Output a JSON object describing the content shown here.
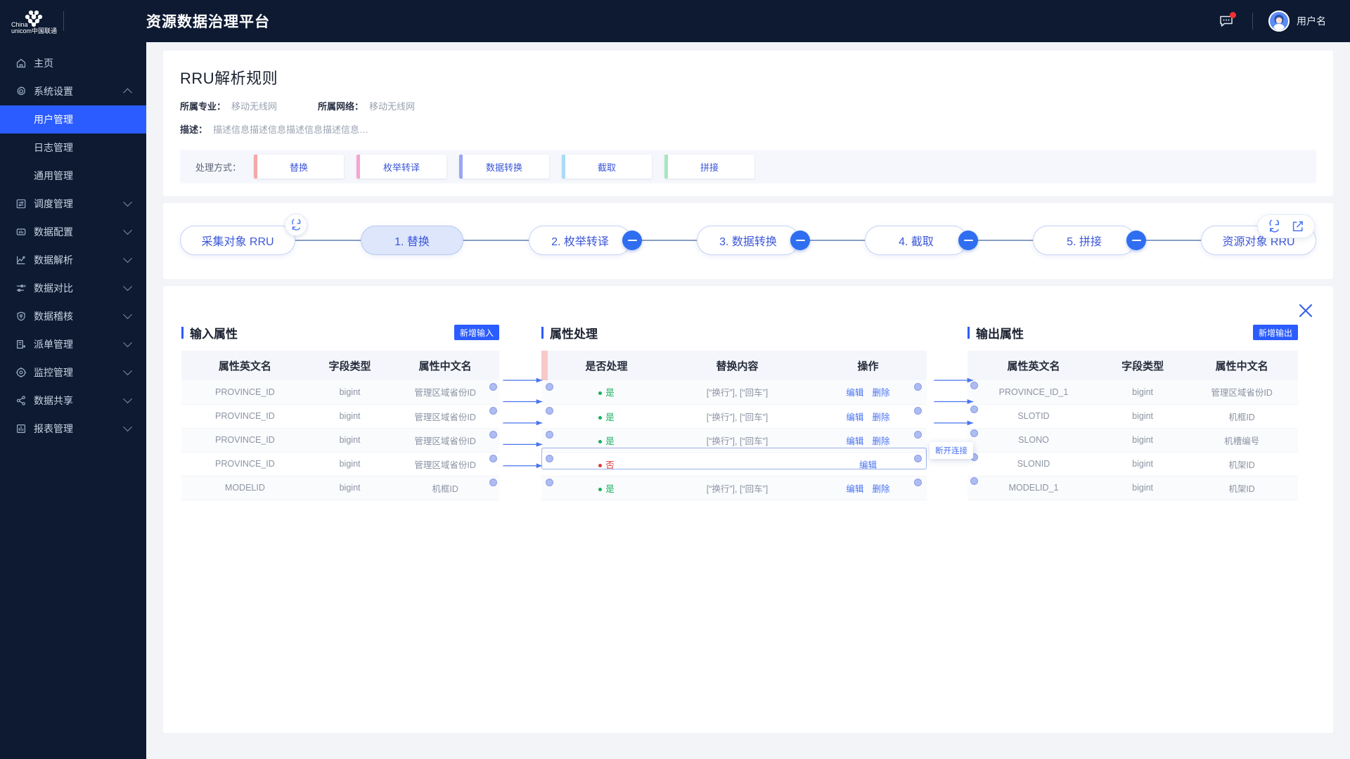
{
  "topbar": {
    "brand_title": "资源数据治理平台",
    "logo_line1": "China",
    "logo_line2": "unicom中国联通",
    "message_icon": "chat-bubble-icon",
    "user_name": "用户名"
  },
  "sidebar": {
    "items": [
      {
        "label": "主页",
        "icon": "home-icon",
        "type": "item",
        "expandable": false,
        "active": false
      },
      {
        "label": "系统设置",
        "icon": "gear-icon",
        "type": "item",
        "expandable": true,
        "expanded": true,
        "active": false
      },
      {
        "label": "用户管理",
        "icon": "",
        "type": "sub",
        "active": true
      },
      {
        "label": "日志管理",
        "icon": "",
        "type": "sub",
        "active": false
      },
      {
        "label": "通用管理",
        "icon": "",
        "type": "sub",
        "active": false
      },
      {
        "label": "调度管理",
        "icon": "schedule-icon",
        "type": "item",
        "expandable": true,
        "expanded": false,
        "active": false
      },
      {
        "label": "数据配置",
        "icon": "database-config-icon",
        "type": "item",
        "expandable": true,
        "expanded": false,
        "active": false
      },
      {
        "label": "数据解析",
        "icon": "chart-parse-icon",
        "type": "item",
        "expandable": true,
        "expanded": false,
        "active": false
      },
      {
        "label": "数据对比",
        "icon": "compare-icon",
        "type": "item",
        "expandable": true,
        "expanded": false,
        "active": false
      },
      {
        "label": "数据稽核",
        "icon": "audit-shield-icon",
        "type": "item",
        "expandable": true,
        "expanded": false,
        "active": false
      },
      {
        "label": "派单管理",
        "icon": "dispatch-icon",
        "type": "item",
        "expandable": true,
        "expanded": false,
        "active": false
      },
      {
        "label": "监控管理",
        "icon": "monitor-icon",
        "type": "item",
        "expandable": true,
        "expanded": false,
        "active": false
      },
      {
        "label": "数据共享",
        "icon": "share-icon",
        "type": "item",
        "expandable": true,
        "expanded": false,
        "active": false
      },
      {
        "label": "报表管理",
        "icon": "report-icon",
        "type": "item",
        "expandable": true,
        "expanded": false,
        "active": false
      }
    ]
  },
  "header": {
    "title": "RRU解析规则",
    "major_label": "所属专业：",
    "major_value": "移动无线网",
    "network_label": "所属网络：",
    "network_value": "移动无线网",
    "desc_label": "描述：",
    "desc_value": "描述信息描述信息描述信息描述信息…"
  },
  "method_strip": {
    "label": "处理方式：",
    "chips": [
      {
        "label": "替换",
        "accent": "#f6a7a7"
      },
      {
        "label": "枚举转译",
        "accent": "#f4a6d4"
      },
      {
        "label": "数据转换",
        "accent": "#9aa6f3"
      },
      {
        "label": "截取",
        "accent": "#a9dcf5"
      },
      {
        "label": "拼接",
        "accent": "#a8e6bd"
      }
    ]
  },
  "flow": {
    "source_node": "采集对象 RRU",
    "target_node": "资源对象 RRU",
    "steps": [
      {
        "label": "1. 替换",
        "active": true,
        "has_minus": false
      },
      {
        "label": "2. 枚举转译",
        "active": false,
        "has_minus": true
      },
      {
        "label": "3. 数据转换",
        "active": false,
        "has_minus": true
      },
      {
        "label": "4. 截取",
        "active": false,
        "has_minus": true
      },
      {
        "label": "5. 拼接",
        "active": false,
        "has_minus": true
      }
    ],
    "source_refresh_icon": "refresh-icon",
    "tools": [
      {
        "icon": "refresh-icon"
      },
      {
        "icon": "edit-square-icon"
      }
    ]
  },
  "mapping": {
    "close_icon": "close-icon",
    "tooltip": "断开连接",
    "input_panel": {
      "title": "输入属性",
      "add_label": "新增输入",
      "columns": [
        "属性英文名",
        "字段类型",
        "属性中文名"
      ],
      "rows": [
        [
          "PROVINCE_ID",
          "bigint",
          "管理区域省份ID"
        ],
        [
          "PROVINCE_ID",
          "bigint",
          "管理区域省份ID"
        ],
        [
          "PROVINCE_ID",
          "bigint",
          "管理区域省份ID"
        ],
        [
          "PROVINCE_ID",
          "bigint",
          "管理区域省份ID"
        ],
        [
          "MODELID",
          "bigint",
          "机框ID"
        ]
      ]
    },
    "process_panel": {
      "title": "属性处理",
      "columns": [
        "是否处理",
        "替换内容",
        "操作"
      ],
      "edit_label": "编辑",
      "delete_label": "删除",
      "rows": [
        {
          "handled": "是",
          "handled_state": "yes",
          "content": "[“换行”], [“回车”]",
          "has_delete": true,
          "selected": false
        },
        {
          "handled": "是",
          "handled_state": "yes",
          "content": "[“换行”], [“回车”]",
          "has_delete": true,
          "selected": false
        },
        {
          "handled": "是",
          "handled_state": "yes",
          "content": "[“换行”], [“回车”]",
          "has_delete": true,
          "selected": false
        },
        {
          "handled": "否",
          "handled_state": "no",
          "content": "",
          "has_delete": false,
          "selected": true
        },
        {
          "handled": "是",
          "handled_state": "yes",
          "content": "[“换行”], [“回车”]",
          "has_delete": true,
          "selected": false
        }
      ]
    },
    "output_panel": {
      "title": "输出属性",
      "add_label": "新增输出",
      "columns": [
        "属性英文名",
        "字段类型",
        "属性中文名"
      ],
      "rows": [
        [
          "PROVINCE_ID_1",
          "bigint",
          "管理区域省份ID"
        ],
        [
          "SLOTID",
          "bigint",
          "机框ID"
        ],
        [
          "SLONO",
          "bigint",
          "机槽编号"
        ],
        [
          "SLONID",
          "bigint",
          "机架ID"
        ],
        [
          "MODELID_1",
          "bigint",
          "机架ID"
        ]
      ]
    }
  },
  "colors": {
    "brand_dark": "#0d1a32",
    "accent_blue": "#2b5cff",
    "link_blue": "#4a74f0",
    "node_blue": "#3b57d8",
    "ok_green": "#19b15c",
    "no_red": "#d93b3b"
  }
}
